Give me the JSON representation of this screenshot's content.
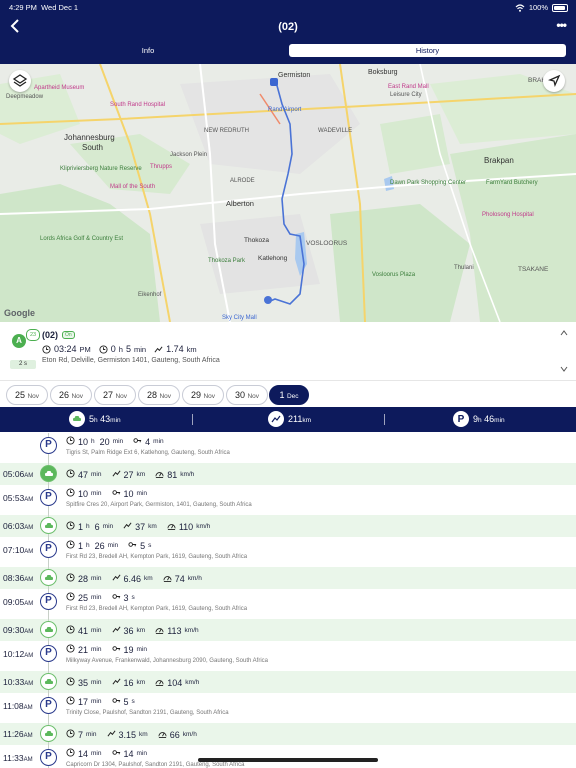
{
  "status_bar": {
    "time": "4:29 PM",
    "date": "Wed Dec 1",
    "battery": "100%"
  },
  "header": {
    "title": "(02)"
  },
  "tabs": [
    {
      "label": "Info"
    },
    {
      "label": "History"
    }
  ],
  "map": {
    "labels": {
      "germiston": "Germiston",
      "boksburg": "Boksburg",
      "brakpan_top": "BRAKPAN",
      "johannesburg": "Johannesburg",
      "johannesburg_south": "South",
      "new_redruth": "NEW REDRUTH",
      "wadeville": "WADEVILLE",
      "alrode": "ALRODE",
      "alberton": "Alberton",
      "brakpan": "Brakpan",
      "katlehong": "Katlehong",
      "thokoza": "Thokoza",
      "vosloorus": "VOSLOORUS",
      "tsakane": "TSAKANE",
      "eikenhof": "Eikenhof",
      "deepmeadow": "Deepmeadow",
      "apartheid_museum": "Apartheid Museum",
      "south_rand_hospital": "South Rand Hospital",
      "thrupps": "Thrupps",
      "mall_of_the_south": "Mall of the South",
      "jackson_plein": "Jackson Plein",
      "klipriviersberg": "Klipriviersberg Nature Reserve",
      "rand_airport": "Rand Airport",
      "leisure_city": "Leisure City",
      "eastrand_mall": "East Rand Mall",
      "pholosong": "Pholosong Hospital",
      "farm_yard": "FarmYard Butchery",
      "dawn_park": "Dawn Park Shopping Center",
      "thulani": "Thulani",
      "thokoza_park": "Thokoza Park",
      "vosloorus_plaza": "Vosloorus Plaza",
      "sky_city": "Sky City Mall",
      "google": "Google",
      "lords_africa": "Lords Africa Golf & Country Est"
    },
    "buttons": {
      "layers": "layers-icon",
      "locate": "navigation-arrow-icon"
    }
  },
  "vehicle": {
    "badge": "A",
    "count": "23",
    "name": "(02)",
    "tag": "On",
    "time": "03:24",
    "time_suffix": "PM",
    "duration_h": "0",
    "duration_h_unit": "h",
    "duration_m": "5",
    "duration_m_unit": "min",
    "distance": "1.74",
    "distance_unit": "km",
    "address": "Eton Rd, Delville, Germiston 1401, Gauteng, South Africa",
    "speed_pill": "2 s"
  },
  "dates": [
    {
      "day": "25",
      "month": "Nov"
    },
    {
      "day": "26",
      "month": "Nov"
    },
    {
      "day": "27",
      "month": "Nov"
    },
    {
      "day": "28",
      "month": "Nov"
    },
    {
      "day": "29",
      "month": "Nov"
    },
    {
      "day": "30",
      "month": "Nov"
    },
    {
      "day": "1",
      "month": "Dec",
      "selected": true
    }
  ],
  "summary": {
    "drive_h": "5",
    "drive_h_unit": "h",
    "drive_m": "43",
    "drive_m_unit": "min",
    "distance": "211",
    "distance_unit": "km",
    "park_h": "9",
    "park_h_unit": "h",
    "park_m": "46",
    "park_m_unit": "min"
  },
  "entries": [
    {
      "type": "park",
      "time": "",
      "time_suffix": "",
      "duration": "10",
      "dunit": "h",
      "duration2": "20",
      "dunit2": "min",
      "idle": "4",
      "idle_unit": "min",
      "address": "Tigris St, Palm Ridge Ext 6, Katlehong, Gauteng, South Africa"
    },
    {
      "type": "drive",
      "time": "05:06",
      "time_suffix": "AM",
      "duration": "47",
      "dunit": "min",
      "distance": "27",
      "distance_unit": "km",
      "speed": "81",
      "speed_unit": "km/h",
      "big": true
    },
    {
      "type": "park",
      "time": "05:53",
      "time_suffix": "AM",
      "duration": "10",
      "dunit": "min",
      "idle": "10",
      "idle_unit": "min",
      "address": "Spitfire Cres 20, Airport Park, Germiston, 1401, Gauteng, South Africa"
    },
    {
      "type": "drive",
      "time": "06:03",
      "time_suffix": "AM",
      "duration": "1",
      "dunit": "h",
      "duration2": "6",
      "dunit2": "min",
      "distance": "37",
      "distance_unit": "km",
      "speed": "110",
      "speed_unit": "km/h"
    },
    {
      "type": "park",
      "time": "07:10",
      "time_suffix": "AM",
      "duration": "1",
      "dunit": "h",
      "duration2": "26",
      "dunit2": "min",
      "idle": "5",
      "idle_unit": "s",
      "address": "First Rd 23, Bredell AH, Kempton Park, 1619, Gauteng, South Africa"
    },
    {
      "type": "drive",
      "time": "08:36",
      "time_suffix": "AM",
      "duration": "28",
      "dunit": "min",
      "distance": "6.46",
      "distance_unit": "km",
      "speed": "74",
      "speed_unit": "km/h"
    },
    {
      "type": "park",
      "time": "09:05",
      "time_suffix": "AM",
      "duration": "25",
      "dunit": "min",
      "idle": "3",
      "idle_unit": "s",
      "address": "First Rd 23, Bredell AH, Kempton Park, 1619, Gauteng, South Africa"
    },
    {
      "type": "drive",
      "time": "09:30",
      "time_suffix": "AM",
      "duration": "41",
      "dunit": "min",
      "distance": "36",
      "distance_unit": "km",
      "speed": "113",
      "speed_unit": "km/h"
    },
    {
      "type": "park",
      "time": "10:12",
      "time_suffix": "AM",
      "duration": "21",
      "dunit": "min",
      "idle": "19",
      "idle_unit": "min",
      "address": "Milkyway Avenue, Frankenwald, Johannesburg 2090, Gauteng, South Africa"
    },
    {
      "type": "drive",
      "time": "10:33",
      "time_suffix": "AM",
      "duration": "35",
      "dunit": "min",
      "distance": "16",
      "distance_unit": "km",
      "speed": "104",
      "speed_unit": "km/h"
    },
    {
      "type": "park",
      "time": "11:08",
      "time_suffix": "AM",
      "duration": "17",
      "dunit": "min",
      "idle": "5",
      "idle_unit": "s",
      "address": "Trinity Close, Paulshof, Sandton 2191, Gauteng, South Africa"
    },
    {
      "type": "drive",
      "time": "11:26",
      "time_suffix": "AM",
      "duration": "7",
      "dunit": "min",
      "distance": "3.15",
      "distance_unit": "km",
      "speed": "66",
      "speed_unit": "km/h"
    },
    {
      "type": "park",
      "time": "11:33",
      "time_suffix": "AM",
      "duration": "14",
      "dunit": "min",
      "idle": "14",
      "idle_unit": "min",
      "address": "Capricorn Dr 1304, Paulshof, Sandton 2191, Gauteng, South Africa"
    }
  ],
  "colors": {
    "navy": "#0d1a5c",
    "drive_bg": "#eaf6ea",
    "drive_green": "#5cb85c",
    "park_blue": "#2a3a8c"
  }
}
